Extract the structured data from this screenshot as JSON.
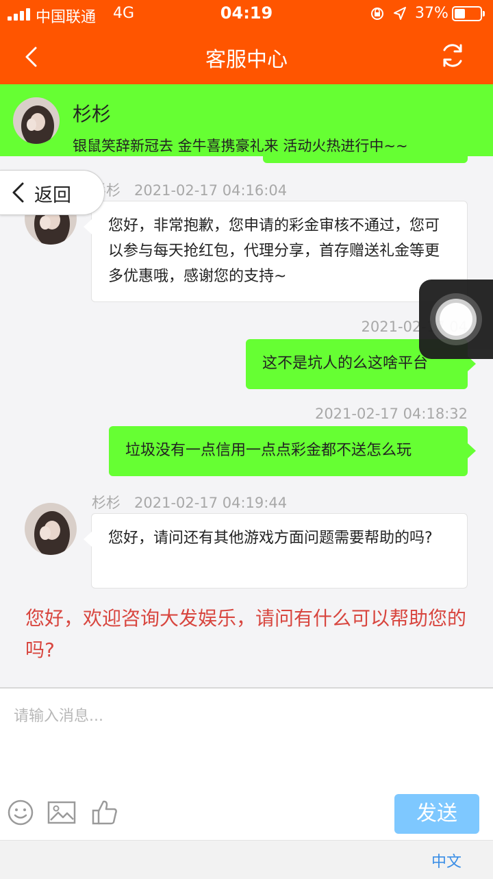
{
  "status_bar": {
    "carrier": "中国联通",
    "network": "4G",
    "time": "04:19",
    "battery": "37%",
    "battery_level": 0.37
  },
  "header": {
    "title": "客服中心",
    "back_icon": "chevron-left-icon",
    "refresh_icon": "refresh-icon",
    "bg_color": "#ff5500"
  },
  "agent": {
    "name": "杉杉",
    "marquee": "银鼠笑辞新冠去 金牛喜携豪礼来 活动火热进行中~~",
    "banner_color": "#66ff33"
  },
  "float_back": {
    "label": "返回"
  },
  "messages": [
    {
      "sender": "agent",
      "name": "杉杉",
      "time": "2021-02-17 04:16:04",
      "text": "您好，非常抱歉，您申请的彩金审核不通过，您可以参与每天抢红包，代理分享，首存赠送礼金等更多优惠哦，感谢您的支持~"
    },
    {
      "sender": "user",
      "time": "2021-02-17 04",
      "text": "这不是坑人的么这啥平台"
    },
    {
      "sender": "user",
      "time": "2021-02-17 04:18:32",
      "text": "垃圾没有一点信用一点点彩金都不送怎么玩"
    },
    {
      "sender": "agent",
      "name": "杉杉",
      "time": "2021-02-17 04:19:44",
      "text": "您好，请问还有其他游戏方面问题需要帮助的吗?"
    }
  ],
  "welcome_text": "您好，欢迎咨询大发娱乐，请问有什么可以帮助您的吗?",
  "input": {
    "placeholder": "请输入消息..."
  },
  "toolbar": {
    "icons": [
      "emoji-icon",
      "image-icon",
      "thumbs-up-icon"
    ],
    "send_label": "发送",
    "send_color": "#7ec8ff"
  },
  "footer": {
    "language": "中文"
  }
}
